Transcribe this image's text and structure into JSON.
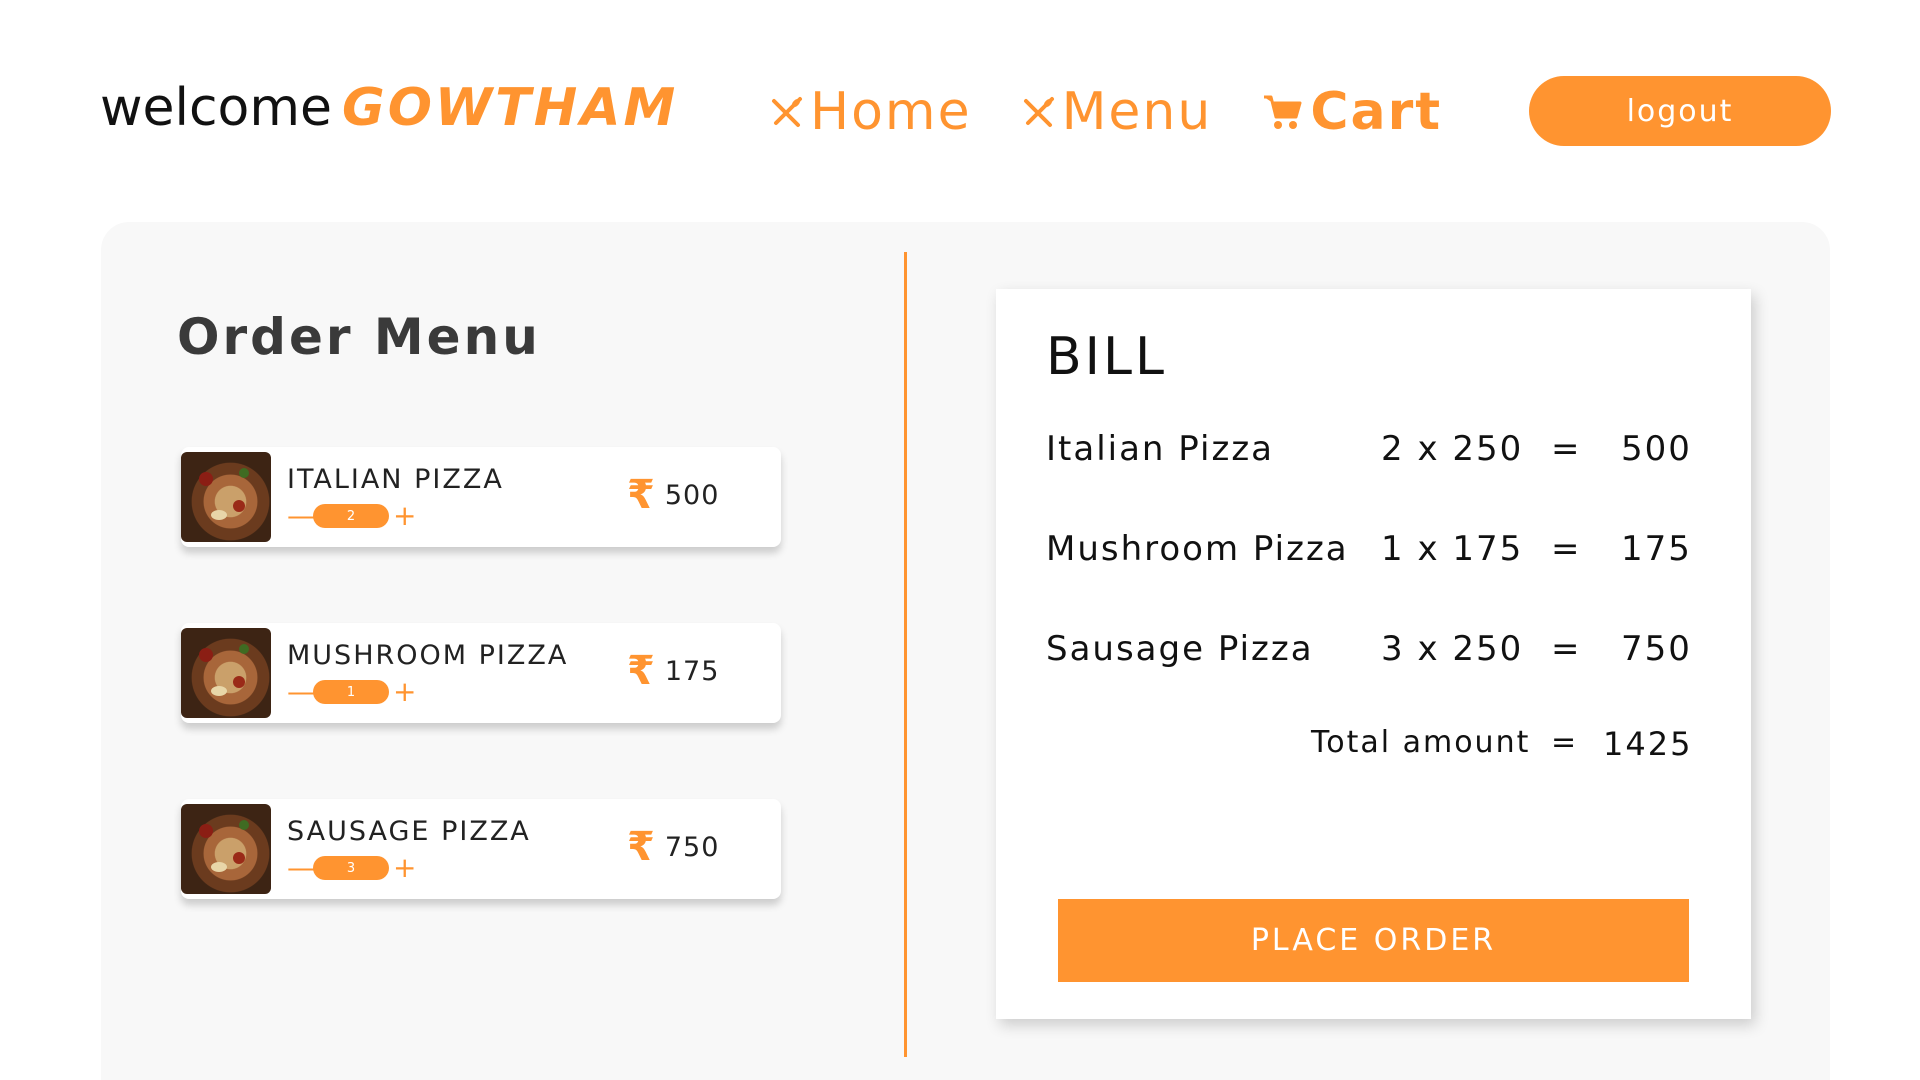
{
  "header": {
    "welcome_text": "welcome",
    "username": "GOWTHAM",
    "nav": [
      {
        "label": "Home",
        "icon": "utensils-icon"
      },
      {
        "label": "Menu",
        "icon": "utensils-icon"
      },
      {
        "label": "Cart",
        "icon": "cart-icon"
      }
    ],
    "logout_label": "logout"
  },
  "colors": {
    "accent": "#ff9430",
    "panel_bg": "#f8f8f8"
  },
  "menu": {
    "title": "Order Menu",
    "currency_symbol": "₹",
    "items": [
      {
        "name": "ITALIAN PIZZA",
        "quantity": "2",
        "price": "500",
        "minus": "—",
        "plus": "+"
      },
      {
        "name": "MUSHROOM PIZZA",
        "quantity": "1",
        "price": "175",
        "minus": "—",
        "plus": "+"
      },
      {
        "name": "SAUSAGE PIZZA",
        "quantity": "3",
        "price": "750",
        "minus": "—",
        "plus": "+"
      }
    ]
  },
  "bill": {
    "title": "BILL",
    "rows": [
      {
        "name": "Italian Pizza",
        "qty": "2 x 250",
        "eq": "=",
        "total": "500"
      },
      {
        "name": "Mushroom Pizza",
        "qty": "1 x 175",
        "eq": "=",
        "total": "175"
      },
      {
        "name": "Sausage Pizza",
        "qty": "3 x 250",
        "eq": "=",
        "total": "750"
      }
    ],
    "total_label": "Total amount",
    "total_eq": "=",
    "total_value": "1425",
    "place_order_label": "PLACE ORDER"
  }
}
